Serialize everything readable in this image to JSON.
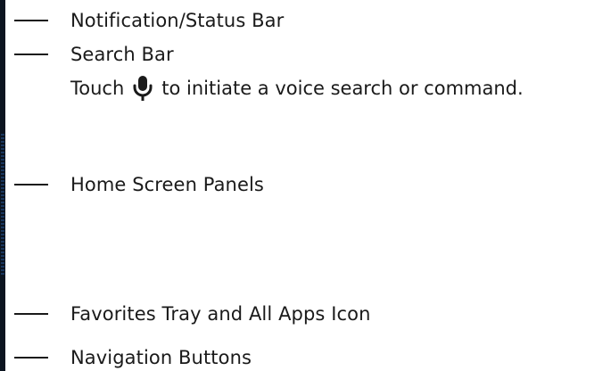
{
  "callouts": [
    {
      "label": "Notification/Status Bar"
    },
    {
      "label": "Search Bar"
    },
    {
      "label": "Home Screen Panels"
    },
    {
      "label": "Favorites Tray and All Apps Icon"
    },
    {
      "label": "Navigation Buttons"
    }
  ],
  "voice_note": {
    "before_icon": "Touch",
    "icon": "microphone-icon",
    "after_icon": "to initiate a voice search or command."
  }
}
